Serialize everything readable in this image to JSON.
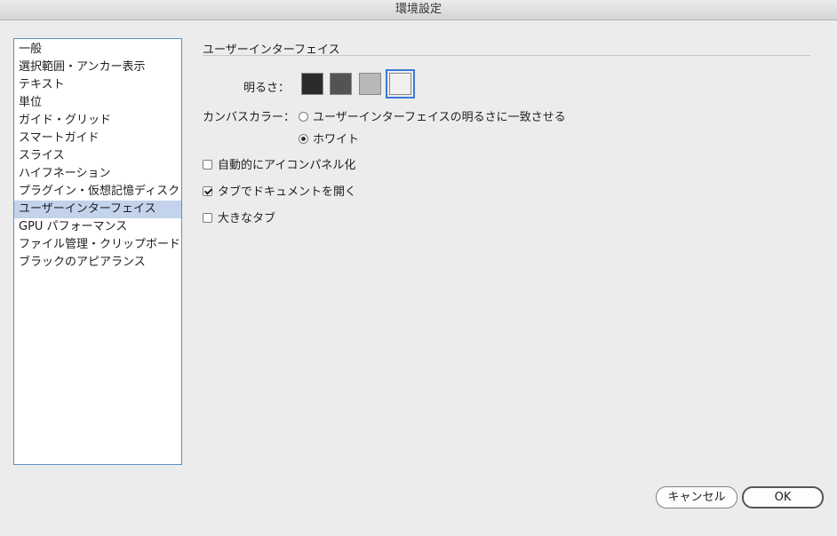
{
  "window": {
    "title": "環境設定"
  },
  "sidebar": {
    "items": [
      "一般",
      "選択範囲・アンカー表示",
      "テキスト",
      "単位",
      "ガイド・グリッド",
      "スマートガイド",
      "スライス",
      "ハイフネーション",
      "プラグイン・仮想記憶ディスク",
      "ユーザーインターフェイス",
      "GPU パフォーマンス",
      "ファイル管理・クリップボード",
      "ブラックのアピアランス"
    ],
    "selected_index": 9
  },
  "panel": {
    "section_title": "ユーザーインターフェイス",
    "brightness": {
      "label": "明るさ：",
      "swatch_colors": [
        "#2b2b2b",
        "#535353",
        "#b8b8b8",
        "#f0f0f0"
      ],
      "selected_index": 3
    },
    "canvas_color": {
      "label": "カンバスカラー：",
      "options": [
        "ユーザーインターフェイスの明るさに一致させる",
        "ホワイト"
      ],
      "selected_index": 1
    },
    "checkboxes": [
      {
        "label": "自動的にアイコンパネル化",
        "checked": false
      },
      {
        "label": "タブでドキュメントを開く",
        "checked": true
      },
      {
        "label": "大きなタブ",
        "checked": false
      }
    ]
  },
  "buttons": {
    "cancel": "キャンセル",
    "ok": "OK"
  }
}
